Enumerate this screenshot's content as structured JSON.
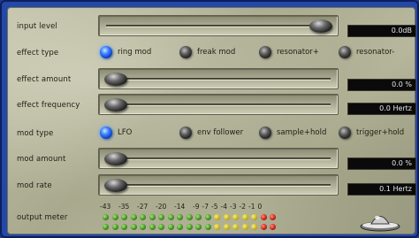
{
  "labels": {
    "input_level": "input level",
    "effect_type": "effect type",
    "effect_amount": "effect amount",
    "effect_frequency": "effect frequency",
    "mod_type": "mod type",
    "mod_amount": "mod amount",
    "mod_rate": "mod rate",
    "output_meter": "output meter"
  },
  "sliders": {
    "input_level": {
      "value_text": "0.0dB",
      "level": 1.0
    },
    "effect_amount": {
      "value_text": "0.0 %",
      "level": 0.0
    },
    "effect_frequency": {
      "value_text": "0.0 Hertz",
      "level": 0.0
    },
    "mod_amount": {
      "value_text": "0.0 %",
      "level": 0.0
    },
    "mod_rate": {
      "value_text": "0.1 Hertz",
      "level": 0.0
    }
  },
  "effect_type": {
    "options": [
      "ring mod",
      "freak mod",
      "resonator+",
      "resonator-"
    ],
    "selected": "ring mod"
  },
  "mod_type": {
    "options": [
      "LFO",
      "env follower",
      "sample+hold",
      "trigger+hold"
    ],
    "selected": "LFO"
  },
  "meter": {
    "scale": [
      "-43",
      "-35",
      "-27",
      "-20",
      "-14",
      "-9",
      "-7",
      "-5",
      "-4",
      "-3",
      "-2",
      "-1",
      "0"
    ],
    "leds_green": 12,
    "leds_yellow": 5,
    "leds_red": 2
  },
  "colors": {
    "frame": "#2448a8",
    "radio_selected": "#3a84ff",
    "display_bg": "#0a0a0a"
  },
  "icons": {
    "logo": "flying-saucer-icon"
  }
}
